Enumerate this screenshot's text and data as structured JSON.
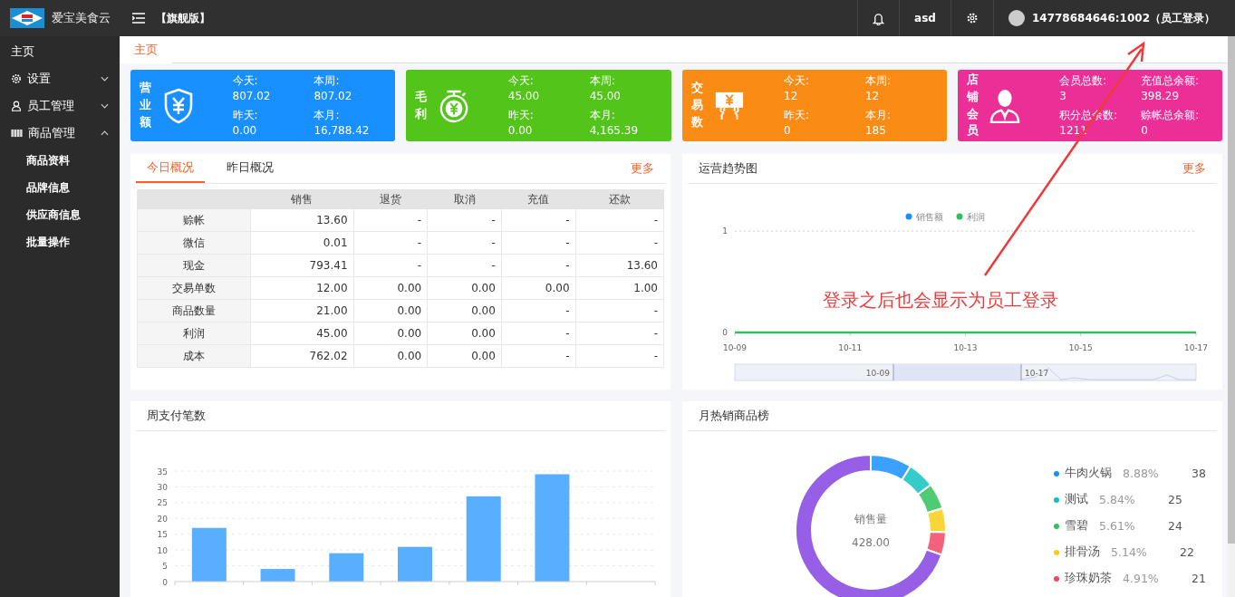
{
  "top_bar": {
    "app_name": "爱宝美食云",
    "edition": "【旗舰版】",
    "user_short": "asd",
    "account": "14778684646:1002（员工登录）"
  },
  "sidebar": {
    "items": [
      {
        "label": "主页"
      },
      {
        "label": "设置",
        "expanded": false
      },
      {
        "label": "员工管理",
        "expanded": false
      },
      {
        "label": "商品管理",
        "expanded": true,
        "children": [
          {
            "label": "商品资料"
          },
          {
            "label": "品牌信息"
          },
          {
            "label": "供应商信息"
          },
          {
            "label": "批量操作"
          }
        ]
      }
    ]
  },
  "page_tabs": [
    {
      "label": "主页",
      "selected": true
    }
  ],
  "stat_cards": [
    {
      "title": "营业额",
      "color": "#1890ff",
      "stats": [
        {
          "label": "今天:",
          "value": "807.02"
        },
        {
          "label": "本周:",
          "value": "807.02"
        },
        {
          "label": "昨天:",
          "value": "0.00"
        },
        {
          "label": "本月:",
          "value": "16,788.42"
        }
      ]
    },
    {
      "title": "毛利",
      "color": "#52c41a",
      "stats": [
        {
          "label": "今天:",
          "value": "45.00"
        },
        {
          "label": "本周:",
          "value": "45.00"
        },
        {
          "label": "昨天:",
          "value": "0.00"
        },
        {
          "label": "本月:",
          "value": "4,165.39"
        }
      ]
    },
    {
      "title": "交易数",
      "color": "#fa8c16",
      "stats": [
        {
          "label": "今天:",
          "value": "12"
        },
        {
          "label": "本周:",
          "value": "12"
        },
        {
          "label": "昨天:",
          "value": "0"
        },
        {
          "label": "本月:",
          "value": "185"
        }
      ]
    },
    {
      "title": "店铺会员",
      "color": "#eb2f96",
      "stats": [
        {
          "label": "会员总数:",
          "value": "3"
        },
        {
          "label": "充值总余额:",
          "value": "398.29"
        },
        {
          "label": "积分总余数:",
          "value": "1211"
        },
        {
          "label": "赊帐总余额:",
          "value": "0"
        }
      ]
    }
  ],
  "overview": {
    "tabs": [
      {
        "label": "今日概况",
        "selected": true
      },
      {
        "label": "昨日概况",
        "selected": false
      }
    ],
    "more": "更多",
    "columns": [
      "",
      "销售",
      "退货",
      "取消",
      "充值",
      "还款"
    ],
    "rows": [
      [
        "赊帐",
        "13.60",
        "-",
        "-",
        "-",
        "-"
      ],
      [
        "微信",
        "0.01",
        "-",
        "-",
        "-",
        "-"
      ],
      [
        "现金",
        "793.41",
        "-",
        "-",
        "-",
        "13.60"
      ],
      [
        "交易单数",
        "12.00",
        "0.00",
        "0.00",
        "0.00",
        "1.00"
      ],
      [
        "商品数量",
        "21.00",
        "0.00",
        "0.00",
        "-",
        "-"
      ],
      [
        "利润",
        "45.00",
        "0.00",
        "0.00",
        "-",
        "-"
      ],
      [
        "成本",
        "762.02",
        "0.00",
        "0.00",
        "-",
        "-"
      ]
    ]
  },
  "trend": {
    "title": "运营趋势图",
    "more": "更多",
    "zoom_start": "10-09",
    "zoom_end": "10-17",
    "chart_data": {
      "type": "line",
      "categories": [
        "10-09",
        "10-11",
        "10-13",
        "10-15",
        "10-17"
      ],
      "ylim": [
        0,
        1
      ],
      "yticks": [
        0,
        1
      ],
      "legend": "top",
      "series": [
        {
          "name": "销售额",
          "color": "#1890ff",
          "values": [
            null,
            null,
            null,
            null,
            null
          ]
        },
        {
          "name": "利润",
          "color": "#2fc25b",
          "values": [
            0,
            0,
            0,
            0,
            0
          ]
        }
      ]
    }
  },
  "weekly": {
    "title": "周支付笔数",
    "chart_data": {
      "type": "bar",
      "ylim": [
        0,
        35
      ],
      "yticks": [
        0,
        5,
        10,
        15,
        20,
        25,
        30,
        35
      ],
      "grid": true,
      "values": [
        17,
        4,
        9,
        11,
        27,
        34,
        0
      ]
    }
  },
  "hot": {
    "title": "月热销商品榜",
    "center_label": "销售量",
    "center_value": "428.00",
    "chart_data": {
      "type": "donut",
      "values": [
        8.88,
        5.84,
        5.61,
        5.14,
        4.91,
        69.62
      ],
      "colors": [
        "#3ba1ff",
        "#36cbcb",
        "#4ecb73",
        "#fbd437",
        "#f2637b",
        "#975fe5"
      ]
    },
    "legend": [
      {
        "name": "牛肉火锅",
        "percent": "8.88%",
        "count": "38",
        "color": "#1890ff"
      },
      {
        "name": "测试",
        "percent": "5.84%",
        "count": "25",
        "color": "#13c2c2"
      },
      {
        "name": "雪碧",
        "percent": "5.61%",
        "count": "24",
        "color": "#2fc25b"
      },
      {
        "name": "排骨汤",
        "percent": "5.14%",
        "count": "22",
        "color": "#facc14"
      },
      {
        "name": "珍珠奶茶",
        "percent": "4.91%",
        "count": "21",
        "color": "#f04864"
      }
    ]
  },
  "annotation": {
    "text": "登录之后也会显示为员工登录"
  }
}
